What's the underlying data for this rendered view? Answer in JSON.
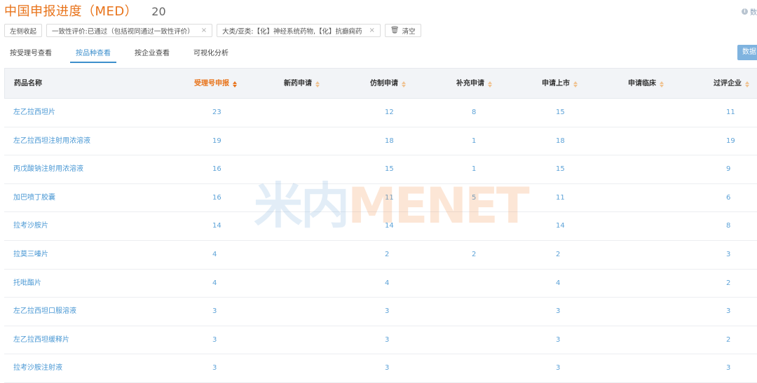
{
  "header": {
    "title": "中国申报进度（MED）",
    "count": "20",
    "info_label": "数"
  },
  "filters": [
    {
      "label": "左侧收起",
      "closable": false
    },
    {
      "label": "一致性评价:已通过（包括视同通过一致性评价）",
      "closable": true
    },
    {
      "label": "大类/亚类:【化】神经系统药物,【化】抗癫痫药",
      "closable": true
    },
    {
      "label": "清空",
      "icon": "trash-icon",
      "closable": false
    }
  ],
  "close_glyph": "×",
  "trash_glyph": "🗑",
  "tabs": [
    {
      "label": "按受理号查看",
      "active": false
    },
    {
      "label": "按品种查看",
      "active": true
    },
    {
      "label": "按企业查看",
      "active": false
    },
    {
      "label": "可视化分析",
      "active": false
    }
  ],
  "data_button": "数据",
  "table": {
    "columns": [
      {
        "label": "药品名称",
        "sortable": false,
        "sorted": false
      },
      {
        "label": "受理号申报",
        "sortable": true,
        "sorted": true
      },
      {
        "label": "新药申请",
        "sortable": true,
        "sorted": false
      },
      {
        "label": "仿制申请",
        "sortable": true,
        "sorted": false
      },
      {
        "label": "补充申请",
        "sortable": true,
        "sorted": false
      },
      {
        "label": "申请上市",
        "sortable": true,
        "sorted": false
      },
      {
        "label": "申请临床",
        "sortable": true,
        "sorted": false
      },
      {
        "label": "过评企业",
        "sortable": true,
        "sorted": false
      }
    ],
    "rows": [
      [
        "左乙拉西坦片",
        "23",
        "",
        "12",
        "8",
        "15",
        "",
        "11"
      ],
      [
        "左乙拉西坦注射用浓溶液",
        "19",
        "",
        "18",
        "1",
        "18",
        "",
        "19"
      ],
      [
        "丙戊酸钠注射用浓溶液",
        "16",
        "",
        "15",
        "1",
        "15",
        "",
        "9"
      ],
      [
        "加巴喷丁胶囊",
        "16",
        "",
        "11",
        "5",
        "11",
        "",
        "6"
      ],
      [
        "拉考沙胺片",
        "14",
        "",
        "14",
        "",
        "14",
        "",
        "8"
      ],
      [
        "拉莫三嗪片",
        "4",
        "",
        "2",
        "2",
        "2",
        "",
        "3"
      ],
      [
        "托吡酯片",
        "4",
        "",
        "4",
        "",
        "4",
        "",
        "2"
      ],
      [
        "左乙拉西坦口服溶液",
        "3",
        "",
        "3",
        "",
        "3",
        "",
        "3"
      ],
      [
        "左乙拉西坦缓释片",
        "3",
        "",
        "3",
        "",
        "3",
        "",
        "2"
      ],
      [
        "拉考沙胺注射液",
        "3",
        "",
        "3",
        "",
        "3",
        "",
        "3"
      ]
    ]
  },
  "watermark": {
    "part1": "米内",
    "part2": "MENET"
  },
  "colors": {
    "accent_orange": "#e8731a",
    "link_blue": "#4a98d4",
    "tab_blue": "#3d8fcc",
    "header_bg": "#f2f4f7"
  }
}
